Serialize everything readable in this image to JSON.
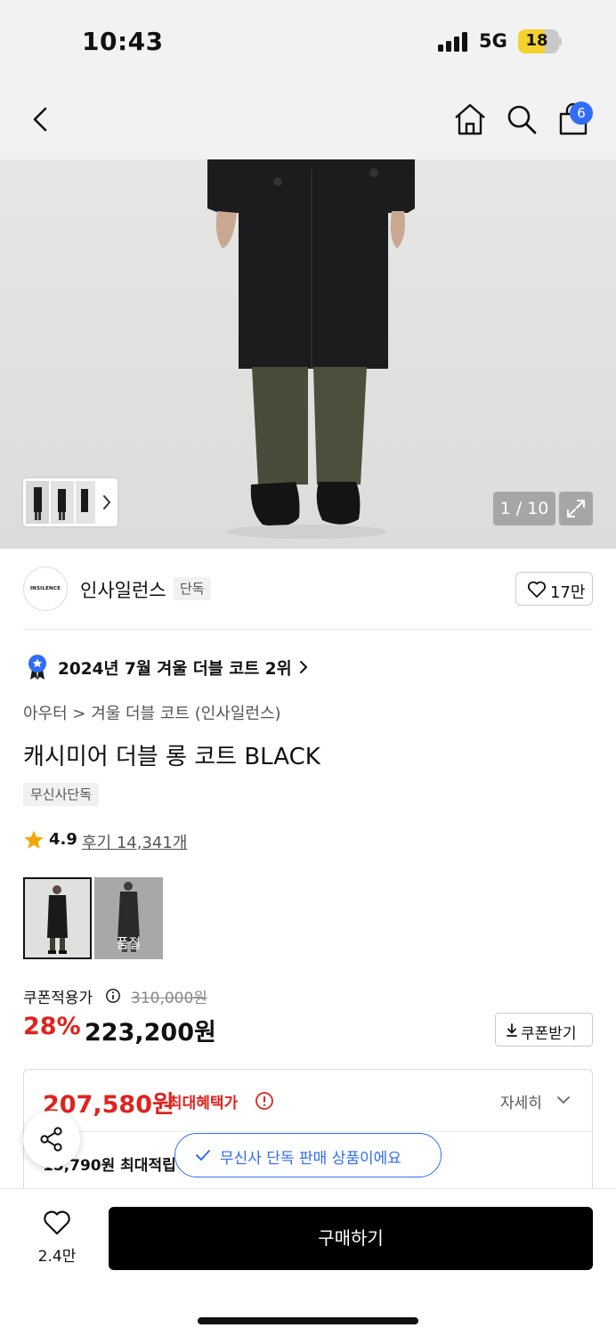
{
  "status_bar": {
    "time": "10:43",
    "network": "5G",
    "battery": "18"
  },
  "nav": {
    "cart_count": "6",
    "icons": [
      "back-icon",
      "home-icon",
      "search-icon",
      "shopping-bag-icon"
    ]
  },
  "gallery": {
    "counter": "1 / 10"
  },
  "brand": {
    "logo_text": "INSILENCE",
    "name": "인사일런스",
    "tag": "단독",
    "likes": "17만"
  },
  "ranking": {
    "text": "2024년 7월 겨울 더블 코트 2위"
  },
  "breadcrumb": "아우터 > 겨울 더블 코트 (인사일런스)",
  "product": {
    "title": "캐시미어 더블 롱 코트 BLACK",
    "exclusive_tag": "무신사단독"
  },
  "rating": {
    "score": "4.9",
    "reviews": "후기 14,341개"
  },
  "options": [
    {
      "label": ""
    },
    {
      "label": "품절"
    }
  ],
  "price": {
    "coupon_label": "쿠폰적용가",
    "original": "310,000원",
    "discount": "28%",
    "sale": "223,200원",
    "coupon_button": "쿠폰받기"
  },
  "benefit": {
    "max_price": "207,580원",
    "max_label": "최대혜택가",
    "detail_link": "자세히",
    "points": "15,790원 최대적립"
  },
  "toast": "무신사 단독 판매 상품이에요",
  "bottom": {
    "wish_count": "2.4만",
    "buy_label": "구매하기"
  },
  "colors": {
    "accent_red": "#e0231d",
    "accent_blue": "#2f6df6",
    "buy_button": "#000000"
  }
}
